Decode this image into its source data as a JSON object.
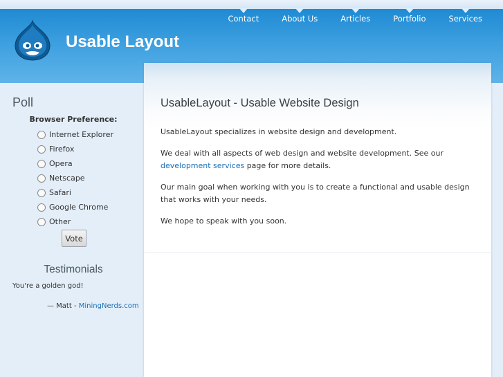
{
  "nav": {
    "items": [
      {
        "label": "Contact"
      },
      {
        "label": "About Us"
      },
      {
        "label": "Articles"
      },
      {
        "label": "Portfolio"
      },
      {
        "label": "Services"
      }
    ]
  },
  "site": {
    "name": "Usable Layout"
  },
  "poll": {
    "title": "Poll",
    "question": "Browser Preference:",
    "choices": [
      "Internet Explorer",
      "Firefox",
      "Opera",
      "Netscape",
      "Safari",
      "Google Chrome",
      "Other"
    ],
    "vote_label": "Vote"
  },
  "testimonials": {
    "title": "Testimonials",
    "quote": "You're a golden god!",
    "author_prefix": "— Matt - ",
    "author_link": "MiningNerds.com"
  },
  "content": {
    "title": "UsableLayout - Usable Website Design",
    "p1": "UsableLayout specializes in website design and development.",
    "p2_before": "We deal with all aspects of web design and website development. See our ",
    "p2_link": "development services",
    "p2_after": " page for more details.",
    "p3": "Our main goal when working with you is to create a functional and usable design that works with your needs.",
    "p4": "We hope to speak with you soon."
  },
  "colors": {
    "header": "#2b8fd6",
    "link": "#1a6fb8",
    "sidebar_bg": "#e4eef8"
  }
}
